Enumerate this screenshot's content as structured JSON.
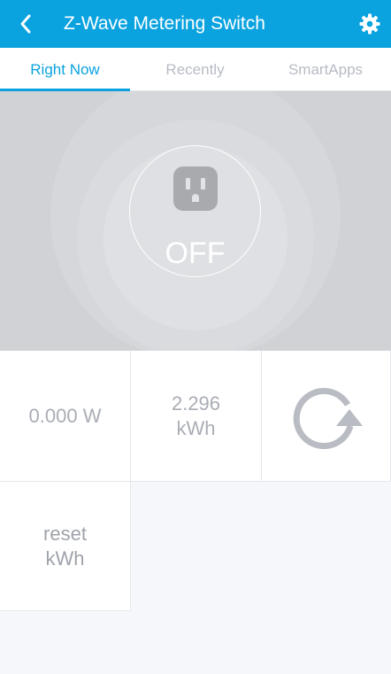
{
  "header": {
    "title": "Z-Wave Metering Switch",
    "back_icon": "chevron-left-icon",
    "settings_icon": "gear-icon",
    "accent_color": "#0aa3df"
  },
  "tabs": [
    {
      "label": "Right Now",
      "active": true
    },
    {
      "label": "Recently",
      "active": false
    },
    {
      "label": "SmartApps",
      "active": false
    }
  ],
  "switch_tile": {
    "icon": "outlet-icon",
    "state": "OFF",
    "background_color": "#d1d2d6"
  },
  "tiles": {
    "power": "0.000 W",
    "energy": "2.296\nkWh",
    "refresh_icon": "refresh-icon",
    "reset": "reset\nkWh"
  }
}
